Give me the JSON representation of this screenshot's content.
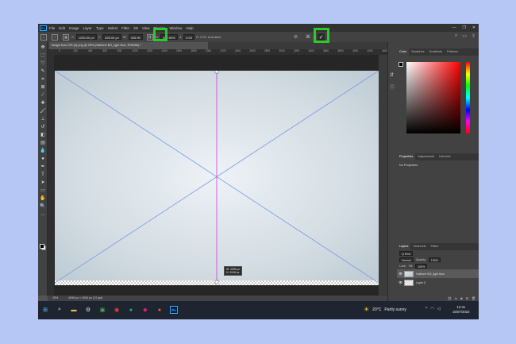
{
  "app": {
    "logo_text": "Ps"
  },
  "menu": [
    "File",
    "Edit",
    "Image",
    "Layer",
    "Type",
    "Select",
    "Filter",
    "3D",
    "View",
    "Plugins",
    "Window",
    "Help"
  ],
  "window_controls": [
    "—",
    "❐",
    "✕"
  ],
  "options_bar": {
    "x_label": "X:",
    "x_value": "1250.00 px",
    "y_label": "Y:",
    "y_value": "325.00 px",
    "w_label": "W:",
    "w_value": "325.90",
    "link_icon": "link-icon",
    "h_label": "H:",
    "h_value": "325.90%",
    "angle_label": "∠",
    "angle_value": "0.00",
    "interp_label": "H: 0.00",
    "antialias": "Anti-alias",
    "confirm_symbol": "✓"
  },
  "document": {
    "tab_title": "Image from iOS (4).png @ 25% (Halftone BG_light blue, RGB/8#) *",
    "ruler_ticks": [
      "0",
      "200",
      "400",
      "600",
      "800",
      "1000",
      "1200",
      "1400",
      "1600",
      "1800",
      "2000",
      "2200",
      "2400",
      "2600",
      "2800",
      "3000",
      "3200",
      "3400",
      "3600",
      "3800",
      "4000",
      "4200",
      "4400"
    ],
    "transform_tip": {
      "w": "W: 4096 px",
      "h": "H: 2048 px"
    }
  },
  "status_bar": {
    "zoom": "25%",
    "size": "4096 px × 3000 px (72 ppi)"
  },
  "panels": {
    "color_tabs": [
      "Color",
      "Swatches",
      "Gradients",
      "Patterns"
    ],
    "properties_tabs": [
      "Properties",
      "Adjustments",
      "Libraries"
    ],
    "properties_body": "No Properties",
    "layers_tabs": [
      "Layers",
      "Channels",
      "Paths"
    ],
    "kind": "Q Kind",
    "blend_mode": "Normal",
    "opacity_label": "Opacity:",
    "opacity_value": "100%",
    "lock_label": "Lock:",
    "fill_label": "Fill:",
    "fill_value": "100%",
    "layers": [
      {
        "name": "Halftone BG_light blue",
        "selected": true
      },
      {
        "name": "Layer 0",
        "selected": false
      }
    ]
  },
  "taskbar": {
    "weather_temp": "20°C",
    "weather_desc": "Partly sunny",
    "time": "12:31",
    "date": "15/07/2022"
  },
  "colors": {
    "highlight": "#2cc92c",
    "guide": "#d23cd2",
    "transform_lines": "#6f8fe6"
  }
}
